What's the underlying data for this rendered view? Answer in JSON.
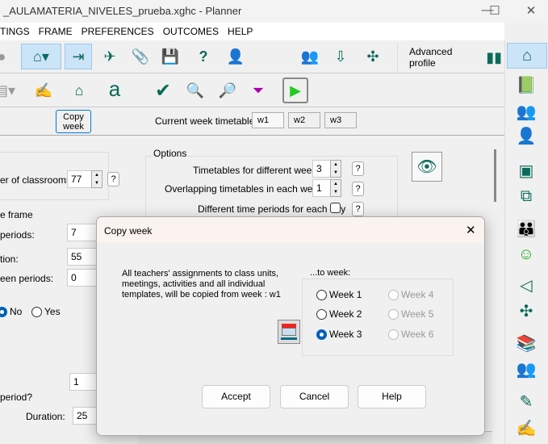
{
  "window": {
    "title": "_AULAMATERIA_NIVELES_prueba.xghc - Planner",
    "minimize": "—",
    "maximize": "☐",
    "close": "✕"
  },
  "menu": [
    "TINGS",
    "FRAME",
    "PREFERENCES",
    "OUTCOMES",
    "HELP"
  ],
  "toolbar": {
    "advanced_profile": "Advanced profile",
    "copy_week": "Copy week",
    "current_week_label": "Current week timetable:",
    "weeks": [
      "w1",
      "w2",
      "w3"
    ]
  },
  "left_panel": {
    "classrooms_label": "er of classrooms:",
    "classrooms": "77",
    "frame_label": "e frame",
    "periods_label": "periods:",
    "periods": "7",
    "duration_label": "tion:",
    "duration": "55",
    "between_label": "een periods:",
    "between": "0",
    "no": "No",
    "yes": "Yes",
    "extra_value": "1",
    "period_q": "period?",
    "duration2_label": "Duration:",
    "duration2": "25",
    "help": "?"
  },
  "options": {
    "title": "Options",
    "weeks_label": "Timetables for different weeks:",
    "weeks_value": "3",
    "overlap_label": "Overlapping timetables in each week:",
    "overlap_value": "1",
    "diff_periods_label": "Different time periods for each day",
    "diff_periods_checked": false
  },
  "dialog": {
    "title": "Copy week",
    "close": "✕",
    "message": "All teachers' assignments to class units, meetings, activities and all individual templates, will be copied from week : w1",
    "group_title": "...to week:",
    "weeks": [
      {
        "label": "Week 1",
        "selected": false,
        "enabled": true
      },
      {
        "label": "Week 2",
        "selected": false,
        "enabled": true
      },
      {
        "label": "Week 3",
        "selected": true,
        "enabled": true
      },
      {
        "label": "Week 4",
        "selected": false,
        "enabled": false
      },
      {
        "label": "Week 5",
        "selected": false,
        "enabled": false
      },
      {
        "label": "Week 6",
        "selected": false,
        "enabled": false
      }
    ],
    "accept": "Accept",
    "cancel": "Cancel",
    "help": "Help"
  },
  "colors": {
    "accent": "#0060b8",
    "icon_teal": "#0a6b5a"
  }
}
